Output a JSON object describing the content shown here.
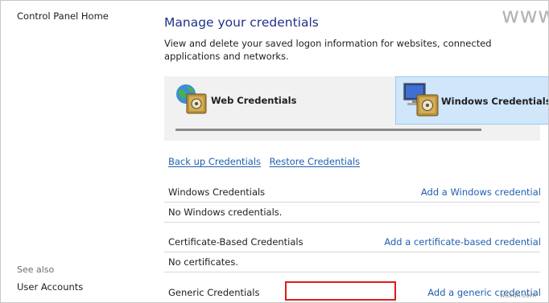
{
  "left_nav": {
    "home_label": "Control Panel Home",
    "see_also_label": "See also",
    "user_accounts_label": "User Accounts"
  },
  "header": {
    "title": "Manage your credentials",
    "description": "View and delete your saved logon information for websites, connected applications and networks."
  },
  "watermark": {
    "text": "www.wintips.org",
    "corner": "wsxdn.com"
  },
  "credential_types": {
    "web_label": "Web Credentials",
    "windows_label": "Windows Credentials",
    "web_icon": "globe-vault-icon",
    "windows_icon": "computer-vault-icon",
    "selected": "Windows Credentials"
  },
  "actions": {
    "backup_label": "Back up Credentials",
    "restore_label": "Restore Credentials"
  },
  "sections": [
    {
      "name": "Windows Credentials",
      "add_label": "Add a Windows credential",
      "empty_text": "No Windows credentials."
    },
    {
      "name": "Certificate-Based Credentials",
      "add_label": "Add a certificate-based credential",
      "empty_text": "No certificates."
    },
    {
      "name": "Generic Credentials",
      "add_label": "Add a generic credential"
    }
  ],
  "colors": {
    "link": "#1f5fb0",
    "title": "#1e3287",
    "highlight_box": "#e11b1b",
    "selected_tile": "#cfe6fb"
  }
}
